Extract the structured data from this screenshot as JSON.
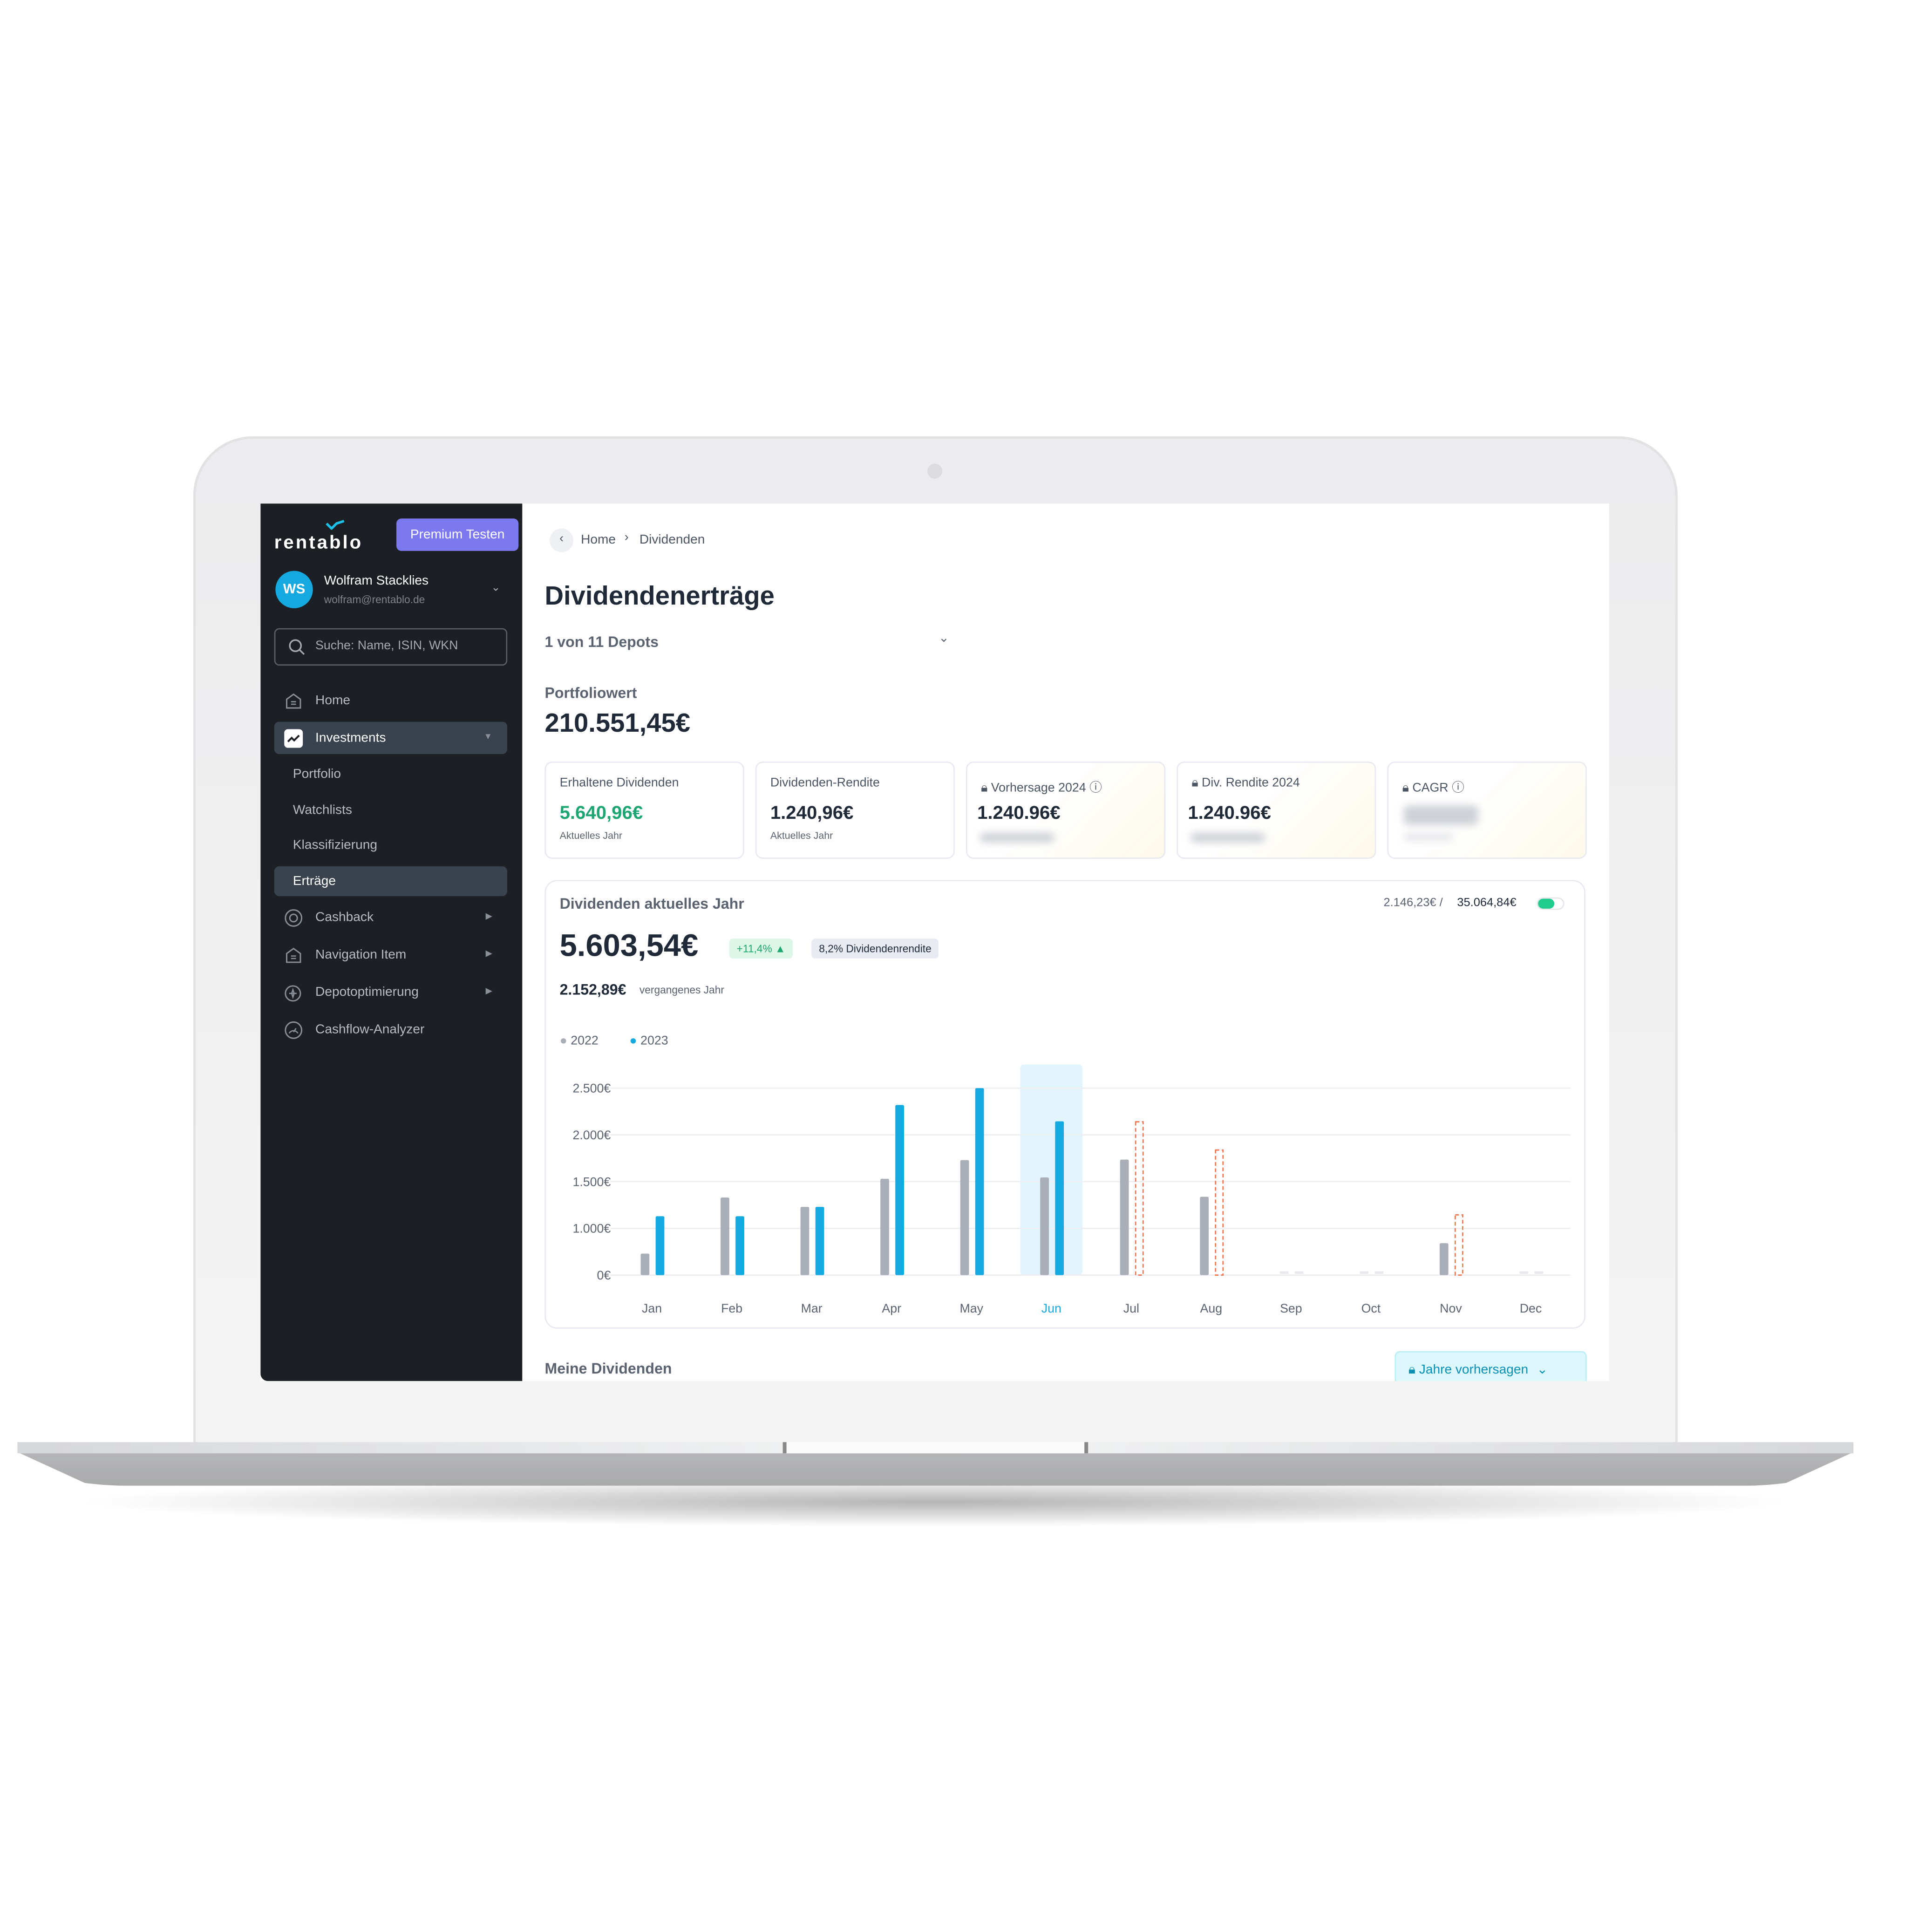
{
  "sidebar": {
    "logo": "rentablo",
    "premium_button": "Premium Testen",
    "user": {
      "initials": "WS",
      "name": "Wolfram Stacklies",
      "email": "wolfram@rentablo.de"
    },
    "search_placeholder": "Suche: Name, ISIN, WKN",
    "items": [
      {
        "label": "Home",
        "icon": "home-icon"
      },
      {
        "label": "Investments",
        "icon": "chart-icon",
        "active": true
      },
      {
        "label": "Portfolio"
      },
      {
        "label": "Watchlists"
      },
      {
        "label": "Klassifizierung"
      },
      {
        "label": "Erträge",
        "active": true
      },
      {
        "label": "Cashback",
        "icon": "cashback-icon"
      },
      {
        "label": "Navigation Item",
        "icon": "home-icon"
      },
      {
        "label": "Depotoptimierung",
        "icon": "sparkle-icon"
      },
      {
        "label": "Cashflow-Analyzer",
        "icon": "gauge-icon"
      }
    ]
  },
  "breadcrumb": {
    "home": "Home",
    "current": "Dividenden"
  },
  "page_title": "Dividendenerträge",
  "depot_selector": "1 von 11 Depots",
  "portfolio": {
    "label": "Portfoliowert",
    "value": "210.551,45€"
  },
  "cards": [
    {
      "label": "Erhaltene Dividenden",
      "value": "5.640,96€",
      "sub": "Aktuelles Jahr"
    },
    {
      "label": "Dividenden-Rendite",
      "value": "1.240,96€",
      "sub": "Aktuelles Jahr"
    },
    {
      "label": "Vorhersage 2024",
      "value": "1.240.96€",
      "locked": true
    },
    {
      "label": "Div. Rendite 2024",
      "value": "1.240.96€",
      "locked": true
    },
    {
      "label": "CAGR",
      "locked": true
    }
  ],
  "dividend_card": {
    "title": "Dividenden aktuelles Jahr",
    "progress_text_a": "2.146,23€ /",
    "progress_text_b": "35.064,84€",
    "total": "5.603,54€",
    "change": "+11,4%",
    "yield_badge": "8,2% Dividendenrendite",
    "last_year_value": "2.152,89€",
    "last_year_label": "vergangenes Jahr"
  },
  "colors": {
    "accent": "#16a9e0",
    "series2022": "#a9aeb7",
    "forecast": "#f2734c",
    "positive": "#1ea672",
    "premium": "#7b78f0"
  },
  "chart_data": {
    "type": "bar",
    "categories": [
      "Jan",
      "Feb",
      "Mar",
      "Apr",
      "May",
      "Jun",
      "Jul",
      "Aug",
      "Sep",
      "Oct",
      "Nov",
      "Dec"
    ],
    "highlighted": "Jun",
    "yticks": [
      "0€",
      "1.000€",
      "1.500€",
      "2.000€",
      "2.500€"
    ],
    "ytick_values": [
      0,
      1000,
      1500,
      2000,
      2500
    ],
    "legend": [
      "2022",
      "2023"
    ],
    "series": [
      {
        "name": "2022",
        "values": [
          460,
          1330,
          1230,
          1530,
          1730,
          1545,
          1736,
          1338,
          0,
          0,
          683,
          0
        ]
      },
      {
        "name": "2023",
        "values": [
          1130,
          1130,
          1230,
          2320,
          2525,
          2145,
          null,
          null,
          null,
          null,
          null,
          null
        ]
      },
      {
        "forecast": true,
        "values": [
          null,
          null,
          null,
          null,
          null,
          null,
          2140,
          1838,
          0,
          0,
          1144,
          0
        ]
      }
    ],
    "grid": true
  },
  "section": {
    "title": "Meine Dividenden",
    "forecast_button": "Jahre vorhersagen"
  }
}
